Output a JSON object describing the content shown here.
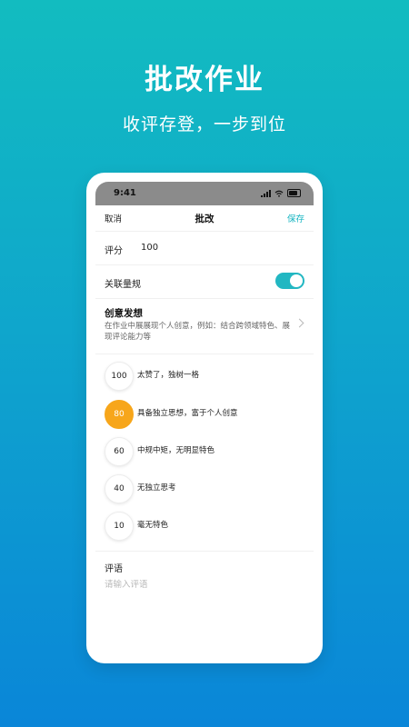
{
  "hero": {
    "title": "批改作业",
    "subtitle": "收评存登，一步到位"
  },
  "status_bar": {
    "time": "9:41"
  },
  "nav": {
    "left": "取消",
    "title": "批改",
    "right": "保存"
  },
  "score": {
    "label": "评分",
    "value": "100"
  },
  "rubric": {
    "label": "关联量规",
    "enabled": true
  },
  "criteria": {
    "title": "创意发想",
    "description": "在作业中展展现个人创意，例如：结合跨领域特色、展现评论能力等"
  },
  "options": [
    {
      "score": "100",
      "text": "太赞了，独树一格",
      "selected": false
    },
    {
      "score": "80",
      "text": "具备独立思想，富于个人创意",
      "selected": true
    },
    {
      "score": "60",
      "text": "中规中矩，无明显特色",
      "selected": false
    },
    {
      "score": "40",
      "text": "无独立思考",
      "selected": false
    },
    {
      "score": "10",
      "text": "毫无特色",
      "selected": false
    }
  ],
  "comment": {
    "label": "评语",
    "placeholder": "请输入评语"
  },
  "colors": {
    "accent": "#17b5c2",
    "selected": "#f7a61b"
  }
}
